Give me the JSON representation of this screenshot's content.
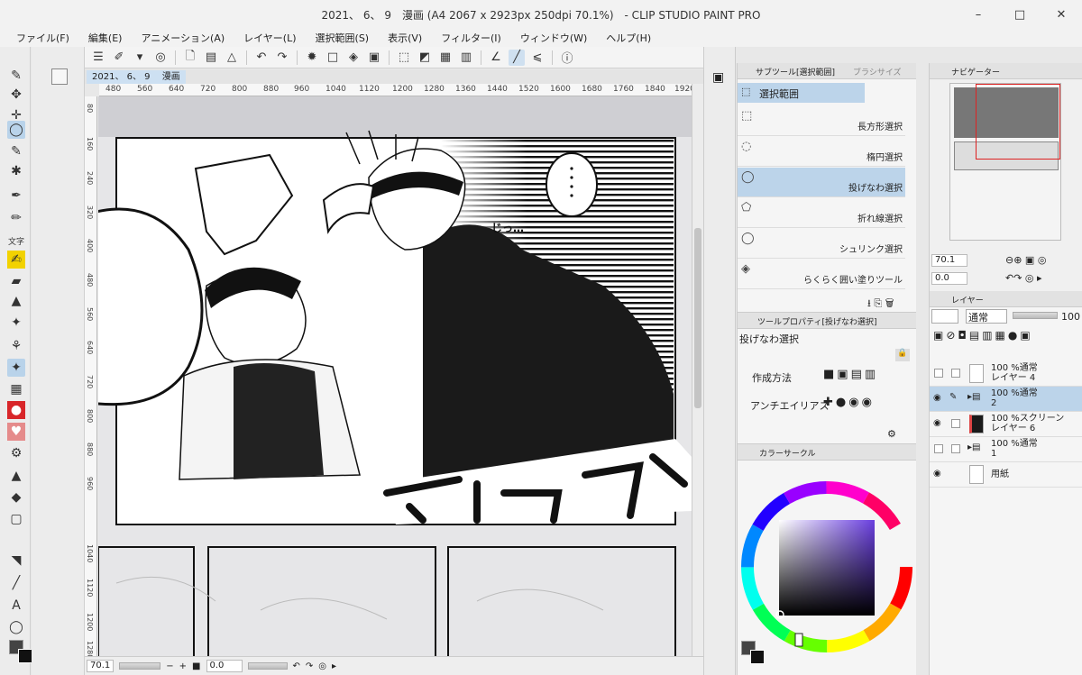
{
  "window": {
    "title": "2021、 6、 9　漫画 (A4 2067 x 2923px 250dpi 70.1%)　- CLIP STUDIO PAINT PRO"
  },
  "menu": [
    "ファイル(F)",
    "編集(E)",
    "アニメーション(A)",
    "レイヤー(L)",
    "選択範囲(S)",
    "表示(V)",
    "フィルター(I)",
    "ウィンドウ(W)",
    "ヘルプ(H)"
  ],
  "canvas": {
    "tab": "2021、 6、 9　 漫画",
    "hruler": [
      "480",
      "560",
      "640",
      "720",
      "800",
      "880",
      "960",
      "1040",
      "1120",
      "1200",
      "1280",
      "1360",
      "1440",
      "1520",
      "1600",
      "1680",
      "1760",
      "1840",
      "1920"
    ],
    "vruler": [
      "80",
      "160",
      "240",
      "320",
      "400",
      "480",
      "560",
      "640",
      "720",
      "800",
      "880",
      "960",
      "1040",
      "1120",
      "1200",
      "1280"
    ],
    "zoom": "70.1",
    "angle": "0.0",
    "sfx": [
      "じっ…"
    ]
  },
  "subtool": {
    "tab_active": "サブツール[選択範囲]",
    "tab_other": "ブラシサイズ",
    "group": "選択範囲",
    "items": [
      {
        "label": "長方形選択",
        "icon": "rect-select-icon"
      },
      {
        "label": "楕円選択",
        "icon": "ellipse-select-icon"
      },
      {
        "label": "投げなわ選択",
        "icon": "lasso-icon"
      },
      {
        "label": "折れ線選択",
        "icon": "polyline-select-icon"
      },
      {
        "label": "シュリンク選択",
        "icon": "shrink-select-icon"
      },
      {
        "label": "らくらく囲い塗りツール",
        "icon": "fill-enclose-icon"
      }
    ],
    "selected_index": 2
  },
  "toolprop": {
    "tab": "ツールプロパティ[投げなわ選択]",
    "name": "投げなわ選択",
    "creation_label": "作成方法",
    "antialias_label": "アンチエイリアス"
  },
  "color": {
    "tab": "カラーサークル",
    "main": "#222222",
    "sub": "#ffffff",
    "hue": "#6a3fe0"
  },
  "navigator": {
    "tab": "ナビゲーター",
    "zoom": "70.1",
    "angle": "0.0"
  },
  "layers": {
    "tab": "レイヤー",
    "blend": "通常",
    "opacity": "100",
    "items": [
      {
        "line1": "100 %通常",
        "line2": "レイヤー 4",
        "visible": false,
        "folder": false,
        "selected": false
      },
      {
        "line1": "100 %通常",
        "line2": "2",
        "visible": true,
        "folder": true,
        "selected": true
      },
      {
        "line1": "100 %スクリーン",
        "line2": "レイヤー 6",
        "visible": true,
        "folder": false,
        "selected": false
      },
      {
        "line1": "100 %通常",
        "line2": "1",
        "visible": false,
        "folder": true,
        "selected": false
      },
      {
        "line1": "用紙",
        "line2": "",
        "visible": true,
        "folder": false,
        "selected": false
      }
    ]
  },
  "tool_icons": [
    "pen-tool-icon",
    "move-layer-icon",
    "move-icon",
    "lasso-select-icon",
    "eyedropper-icon",
    "pen-icon",
    "sparkle-icon",
    "brush-icon",
    "pencil-icon",
    "text-icon",
    "marker-icon",
    "eraser-icon",
    "blend-icon",
    "sparkle-icon",
    "grass-icon",
    "sparkle-icon",
    "pattern-icon",
    "color-icon",
    "watercolor-icon",
    "gear-icon",
    "droplet-icon",
    "fill-icon",
    "rectangle-icon",
    "gradient-icon",
    "line-icon",
    "text-icon",
    "speech-balloon-icon"
  ]
}
